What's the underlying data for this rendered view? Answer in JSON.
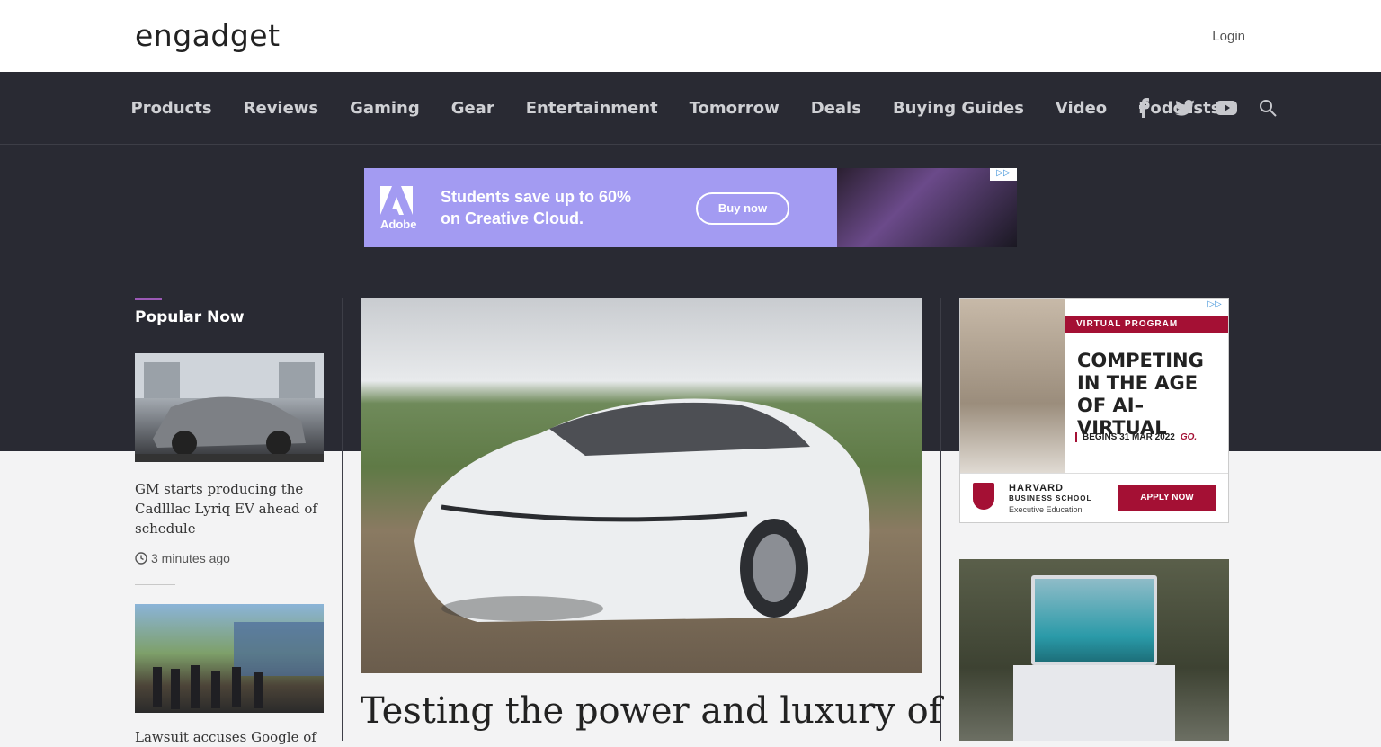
{
  "header": {
    "logo": "engadget",
    "login": "Login"
  },
  "nav": {
    "items": [
      "Products",
      "Reviews",
      "Gaming",
      "Gear",
      "Entertainment",
      "Tomorrow",
      "Deals",
      "Buying Guides",
      "Video",
      "Podcasts"
    ],
    "social": [
      "facebook-icon",
      "twitter-icon",
      "youtube-icon",
      "search-icon"
    ]
  },
  "ad_banner": {
    "brand": "Adobe",
    "line1": "Students save up to 60%",
    "line2": "on Creative Cloud.",
    "cta": "Buy now",
    "bg_color": "#a39bf2"
  },
  "popular": {
    "title": "Popular Now",
    "accent": "#9b59b6",
    "articles": [
      {
        "title": "GM starts producing the Cadlllac Lyriq EV ahead of schedule",
        "time": "3 minutes ago"
      },
      {
        "title": "Lawsuit accuses Google of"
      }
    ]
  },
  "hero": {
    "title": "Testing the power and luxury of"
  },
  "side_ad": {
    "tag": "VIRTUAL PROGRAM",
    "headline": [
      "COMPETING",
      "IN THE AGE",
      "OF AI–VIRTUAL"
    ],
    "begins": "BEGINS 31 MAR 2022",
    "go": "GO.",
    "org_line1": "HARVARD",
    "org_line2": "BUSINESS SCHOOL",
    "org_line3": "Executive Education",
    "cta": "APPLY NOW",
    "brand_color": "#a41034"
  }
}
